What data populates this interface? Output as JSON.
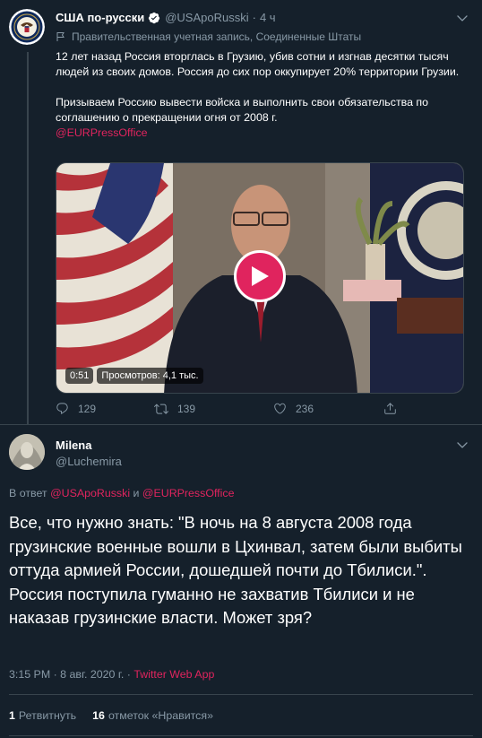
{
  "tweet": {
    "author_name": "США по-русски",
    "handle": "@USApoRusski",
    "time": "4 ч",
    "separator": "·",
    "gov_label": "Правительственная учетная запись, Соединенные Штаты",
    "paragraph1": "12 лет назад Россия вторглась в Грузию, убив сотни и изгнав десятки тысяч людей из своих домов. Россия до сих пор оккупирует 20% территории Грузии.",
    "paragraph2": "Призываем Россию вывести войска и выполнить свои обязательства по соглашению о прекращении огня от 2008 г.",
    "mention": "@EURPressOffice",
    "video": {
      "duration": "0:51",
      "views": "Просмотров: 4,1 тыс."
    },
    "actions": {
      "replies": "129",
      "retweets": "139",
      "likes": "236"
    }
  },
  "reply": {
    "author_name": "Milena",
    "handle": "@Luchemira",
    "reply_prefix": "В ответ",
    "reply_mention1": "@USApoRusski",
    "reply_and": "и",
    "reply_mention2": "@EURPressOffice",
    "text": "Все, что нужно знать: \"В ночь на 8 августа 2008 года грузинские военные вошли в Цхинвал, затем были выбиты оттуда армией России, дошедшей почти до Тбилиси.\". Россия поступила гуманно не захватив Тбилиси и не наказав грузинские власти.  Может зря?",
    "timestamp": "3:15 PM · 8 авг. 2020 г.",
    "meta_sep": "·",
    "source": "Twitter Web App",
    "retweet_count": "1",
    "retweet_label": "Ретвитнуть",
    "like_count": "16",
    "like_label": "отметок «Нравится»"
  },
  "colors": {
    "background": "#15202b",
    "accent": "#e0245e",
    "muted": "#8899a6",
    "border": "#38444d"
  },
  "icons": [
    "verified-icon",
    "chevron-down-icon",
    "flag-icon",
    "play-icon",
    "reply-icon",
    "retweet-icon",
    "like-icon",
    "share-icon"
  ]
}
